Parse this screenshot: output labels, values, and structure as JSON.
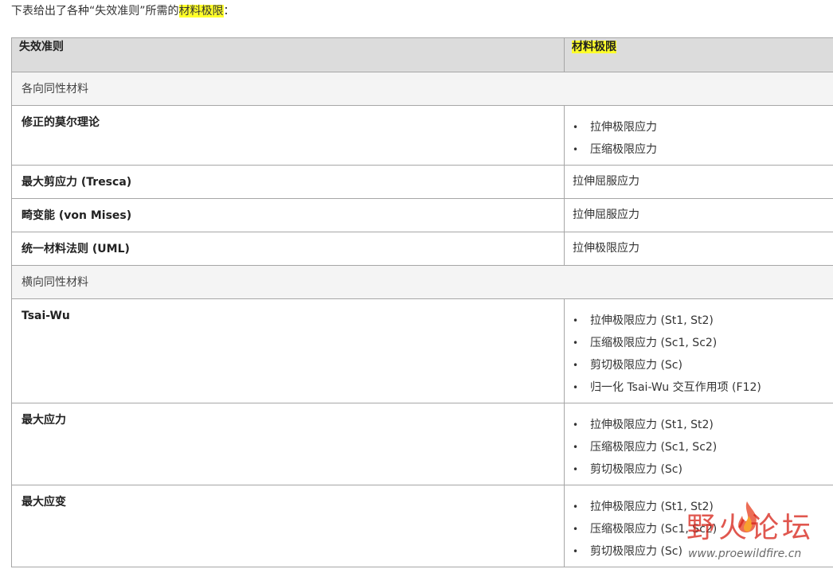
{
  "intro": {
    "text_before": "下表给出了各种“失效准则”所需的",
    "highlight": "材料极限",
    "text_after": "："
  },
  "table": {
    "headers": {
      "criterion": "失效准则",
      "limits": "材料极限"
    },
    "groups": [
      {
        "label": "各向同性材料",
        "rows": [
          {
            "criterion": "修正的莫尔理论",
            "limits": [
              "拉伸极限应力",
              "压缩极限应力"
            ]
          },
          {
            "criterion": "最大剪应力 (Tresca)",
            "value": "拉伸屈服应力"
          },
          {
            "criterion": "畸变能 (von Mises)",
            "value": "拉伸屈服应力"
          },
          {
            "criterion": "统一材料法则 (UML)",
            "value": "拉伸极限应力"
          }
        ]
      },
      {
        "label": "横向同性材料",
        "rows": [
          {
            "criterion": "Tsai-Wu",
            "limits": [
              "拉伸极限应力 (St1, St2)",
              "压缩极限应力 (Sc1, Sc2)",
              "剪切极限应力 (Sc)",
              "归一化 Tsai-Wu 交互作用项 (F12)"
            ]
          },
          {
            "criterion": "最大应力",
            "limits": [
              "拉伸极限应力 (St1, St2)",
              "压缩极限应力 (Sc1, Sc2)",
              "剪切极限应力 (Sc)"
            ]
          },
          {
            "criterion": "最大应变",
            "limits": [
              "拉伸极限应力 (St1, St2)",
              "压缩极限应力 (Sc1, Sc2)",
              "剪切极限应力 (Sc)"
            ]
          }
        ]
      }
    ],
    "bullet": "•"
  },
  "watermark": {
    "title": "野火论坛",
    "url": "www.proewildfire.cn"
  },
  "colors": {
    "highlight": "#ffff2a",
    "header_bg": "#dcdcdc",
    "group_bg": "#f4f4f4",
    "border": "#a6a6a6",
    "watermark_red": "#d7281e"
  }
}
